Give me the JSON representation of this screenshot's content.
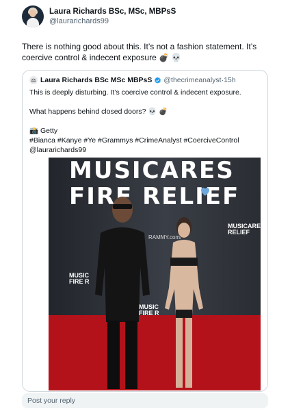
{
  "author": {
    "display_name": "Laura Richards BSc, MSc, MBPsS",
    "handle": "@laurarichards99"
  },
  "tweet": {
    "text": "There is nothing good about this. It’s not a fashion statement. It’s coercive control & indecent exposure 💣 💀"
  },
  "quote": {
    "avatar_emoji": "⚖",
    "display_name": "Laura Richards BSc MSc MBPsS",
    "handle": "@thecrimeanalyst",
    "dot": "·",
    "time": "15h",
    "line1": "This is deeply disturbing. It’s coercive control & indecent exposure.",
    "line2": "What happens behind closed doors? 💀 💣",
    "line3": "📸 Getty",
    "line4": "#Bianca #Kanye #Ye #Grammys #CrimeAnalyst #CoerciveControl",
    "line5": "@laurarichards99",
    "photo": {
      "banner_line1": "MUSICARES",
      "banner_line2": "FIRE RELIEF",
      "banner_url": "RAMMY.com/",
      "side_logo_1": "MUSIC FIRE R",
      "side_logo_2": "MUSICARES RELIEF",
      "side_logo_3": "MUSIC FIRE R"
    }
  },
  "reply": {
    "placeholder": "Post your reply"
  },
  "colors": {
    "verified": "#1d9bf0",
    "carpet": "#b4121a",
    "text_secondary": "#536471"
  }
}
